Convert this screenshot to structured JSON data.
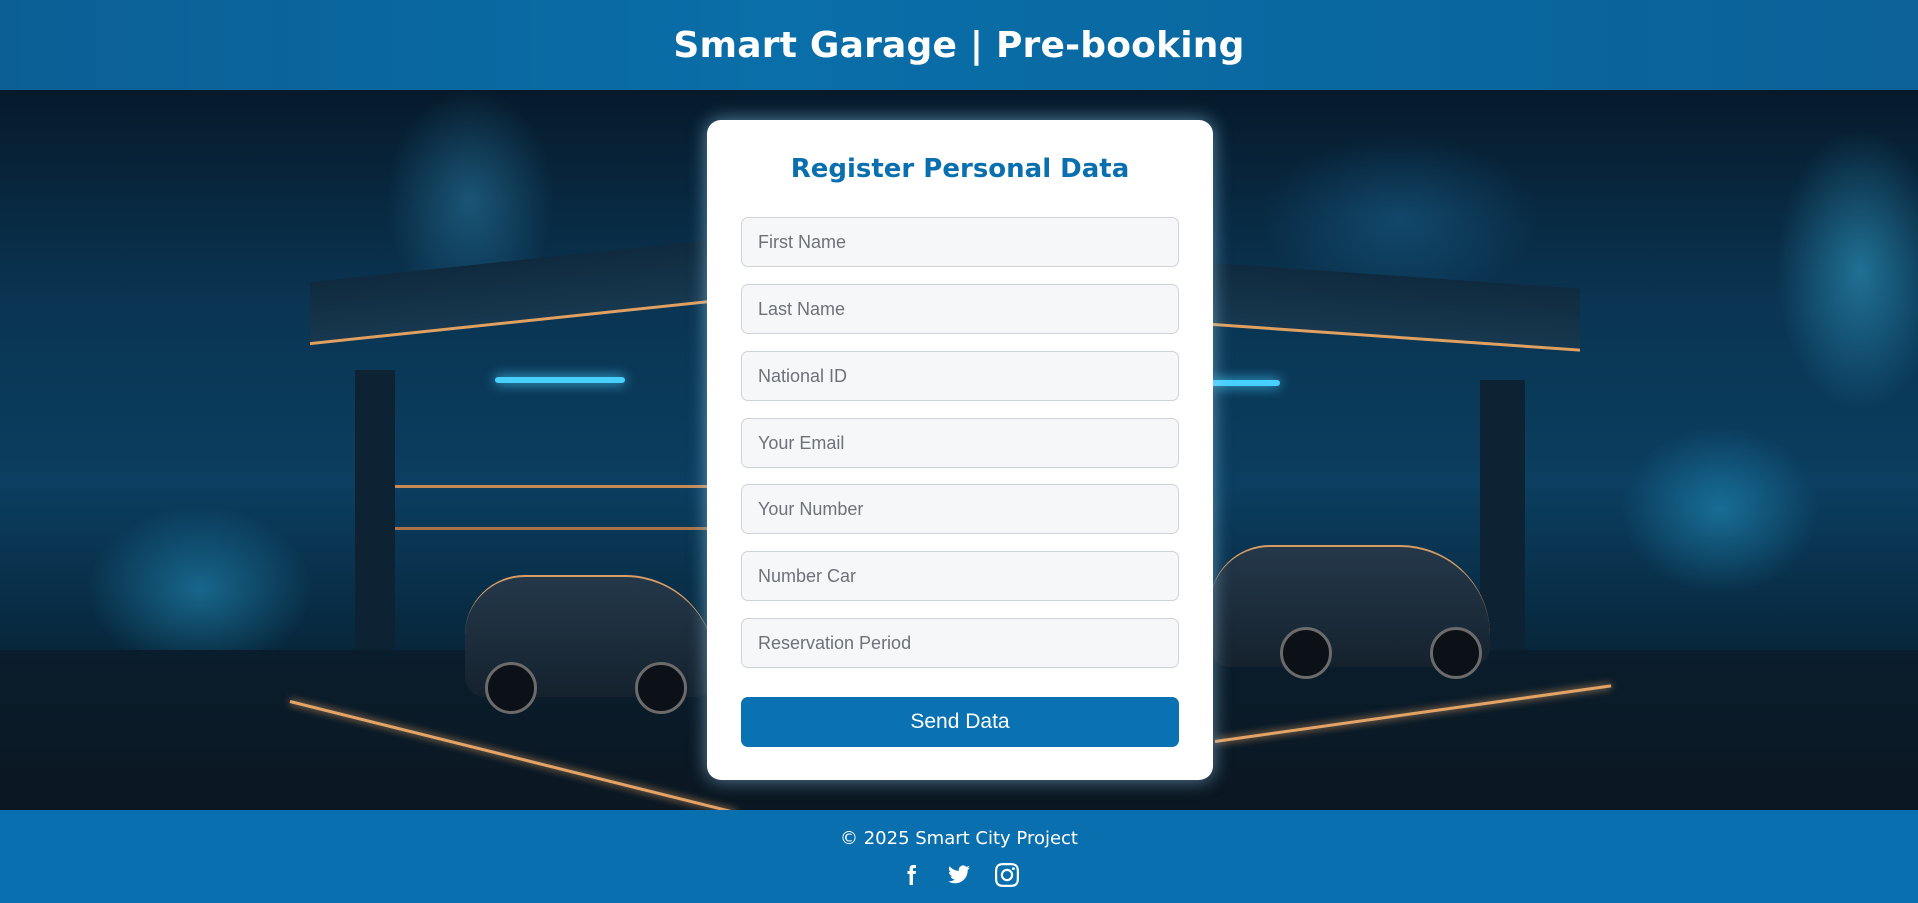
{
  "header": {
    "title": "Smart Garage | Pre-booking"
  },
  "form": {
    "title": "Register Personal Data",
    "fields": [
      {
        "placeholder": "First Name",
        "value": ""
      },
      {
        "placeholder": "Last Name",
        "value": ""
      },
      {
        "placeholder": "National ID",
        "value": ""
      },
      {
        "placeholder": "Your Email",
        "value": ""
      },
      {
        "placeholder": "Your Number",
        "value": ""
      },
      {
        "placeholder": "Number Car",
        "value": ""
      },
      {
        "placeholder": "Reservation Period",
        "value": ""
      }
    ],
    "submit_label": "Send Data"
  },
  "footer": {
    "copyright": "© 2025 Smart City Project",
    "socials": [
      {
        "icon": "facebook-icon"
      },
      {
        "icon": "twitter-icon"
      },
      {
        "icon": "instagram-icon"
      }
    ]
  },
  "colors": {
    "brand": "#0a6fae",
    "button": "#0a72b3",
    "title": "#0a6fae"
  }
}
